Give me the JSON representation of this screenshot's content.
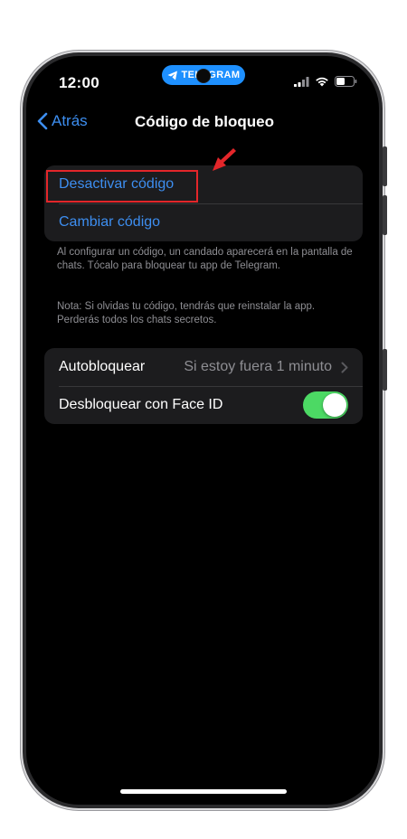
{
  "status_bar": {
    "time": "12:00",
    "app_pill_label": "TELEGRAM",
    "icons": [
      "cellular-signal-icon",
      "wifi-icon",
      "battery-icon"
    ]
  },
  "nav": {
    "back_label": "Atrás",
    "title": "Código de bloqueo"
  },
  "passcode_group": {
    "items": [
      {
        "label": "Desactivar código"
      },
      {
        "label": "Cambiar código"
      }
    ],
    "footer": "Al configurar un código, un candado aparecerá en la pantalla de chats. Tócalo para bloquear tu app de Telegram.",
    "note": "Nota: Si olvidas tu código, tendrás que reinstalar la app. Perderás todos los chats secretos."
  },
  "settings_group": {
    "autolock_label": "Autobloquear",
    "autolock_value": "Si estoy fuera 1 minuto",
    "faceid_label": "Desbloquear con Face ID",
    "faceid_enabled": true
  },
  "colors": {
    "accent": "#3d8ef0",
    "toggle_on": "#4cd964",
    "annotation": "#e3262a",
    "telegram_blue": "#1e90ff"
  }
}
